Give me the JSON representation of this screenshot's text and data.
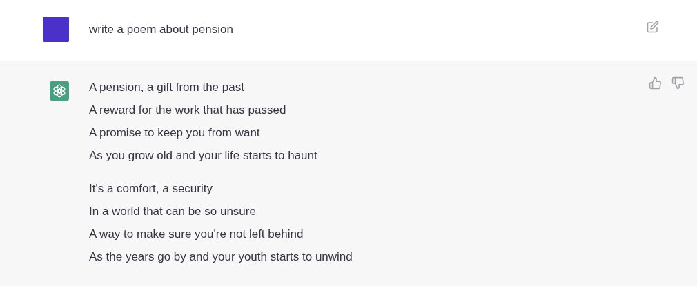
{
  "messages": [
    {
      "kind": "prompt",
      "text": "write a poem about pension"
    },
    {
      "kind": "response",
      "stanzas": [
        [
          "A pension, a gift from the past",
          "A reward for the work that has passed",
          "A promise to keep you from want",
          "As you grow old and your life starts to haunt"
        ],
        [
          "It's a comfort, a security",
          "In a world that can be so unsure",
          "A way to make sure you're not left behind",
          "As the years go by and your youth starts to unwind"
        ]
      ]
    }
  ]
}
